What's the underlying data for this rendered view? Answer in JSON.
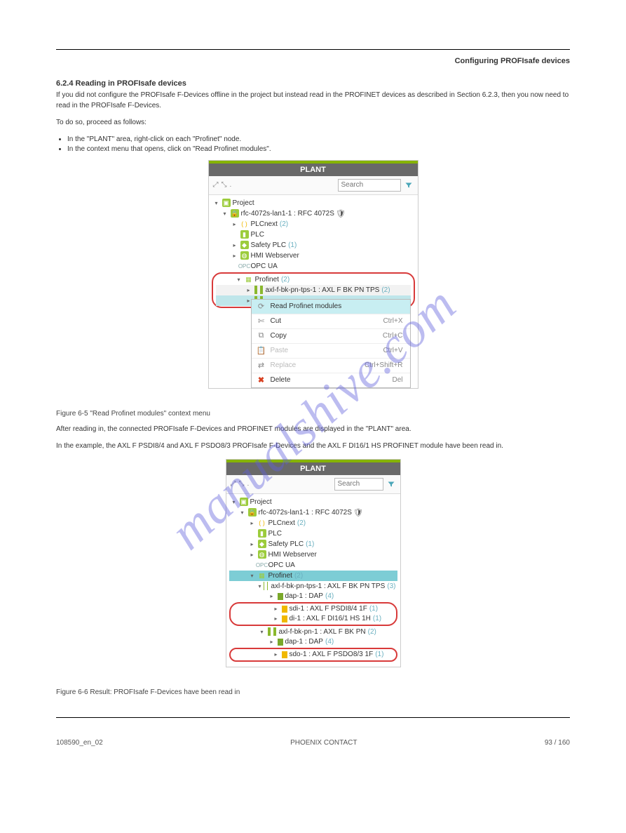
{
  "header_right": "Configuring PROFIsafe devices",
  "section_title": "6.2.4 Reading in PROFIsafe devices",
  "figure1_caption": "Figure 6-5 \"Read Profinet modules\" context menu",
  "figure2_caption": "Figure 6-6 Result: PROFIsafe F-Devices have been read in",
  "paragraphs": {
    "p1": "If you did not configure the PROFIsafe F-Devices offline in the project but instead read in the PROFINET devices as described in Section 6.2.3, then you now need to read in the PROFIsafe F-Devices.",
    "p2": "To do so, proceed as follows:",
    "p3": "After reading in, the connected PROFIsafe F-Devices and PROFINET modules are displayed in the \"PLANT\" area.",
    "p4": "In the example, the AXL F PSDI8/4 and AXL F PSDO8/3 PROFIsafe F-Devices and the AXL F DI16/1 HS PROFINET module have been read in."
  },
  "steps": [
    "In the \"PLANT\" area, right-click on each \"Profinet\" node.",
    "In the context menu that opens, click on \"Read Profinet modules\"."
  ],
  "panel": {
    "title": "PLANT",
    "search_placeholder": "Search",
    "tree1": {
      "project": "Project",
      "rfc": "rfc-4072s-lan1-1 : RFC 4072S",
      "plcnext": "PLCnext",
      "plcnext_count": "(2)",
      "plc": "PLC",
      "safety": "Safety PLC",
      "safety_count": "(1)",
      "hmi": "HMI Webserver",
      "opc": "OPC UA",
      "profinet": "Profinet",
      "profinet_count": "(2)",
      "dev1": "axl-f-bk-pn-tps-1 : AXL F BK PN TPS",
      "dev1_count": "(2)"
    },
    "ctx": {
      "read": "Read Profinet modules",
      "cut": "Cut",
      "cut_k": "Ctrl+X",
      "copy": "Copy",
      "copy_k": "Ctrl+C",
      "paste": "Paste",
      "paste_k": "Ctrl+V",
      "replace": "Replace",
      "replace_k": "Ctrl+Shift+R",
      "delete": "Delete",
      "delete_k": "Del"
    },
    "tree2": {
      "project": "Project",
      "rfc": "rfc-4072s-lan1-1 : RFC 4072S",
      "plcnext": "PLCnext",
      "plcnext_count": "(2)",
      "plc": "PLC",
      "safety": "Safety PLC",
      "safety_count": "(1)",
      "hmi": "HMI Webserver",
      "opc": "OPC UA",
      "profinet": "Profinet",
      "profinet_count": "(2)",
      "dev1": "axl-f-bk-pn-tps-1 : AXL F BK PN TPS",
      "dev1_count": "(3)",
      "dap1": "dap-1 : DAP",
      "dap1_count": "(4)",
      "sdi": "sdi-1 : AXL F PSDI8/4 1F",
      "sdi_count": "(1)",
      "di": "di-1 : AXL F DI16/1 HS 1H",
      "di_count": "(1)",
      "dev2": "axl-f-bk-pn-1 : AXL F BK PN",
      "dev2_count": "(2)",
      "dap2": "dap-1 : DAP",
      "dap2_count": "(4)",
      "sdo": "sdo-1 : AXL F PSDO8/3 1F",
      "sdo_count": "(1)"
    }
  },
  "footer": {
    "left": "108590_en_02",
    "center": "PHOENIX CONTACT",
    "right": "93 / 160"
  },
  "watermark": "manualshive.com"
}
